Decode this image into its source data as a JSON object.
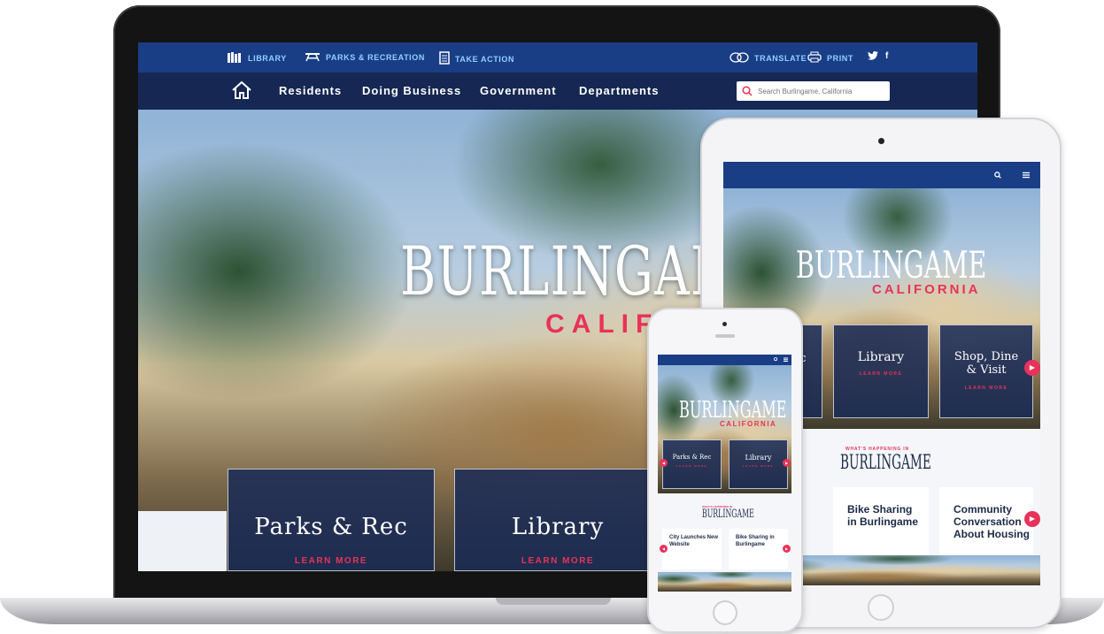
{
  "laptop": {
    "topbar": {
      "library": "LIBRARY",
      "parks": "PARKS & RECREATION",
      "take_action": "TAKE ACTION",
      "translate": "TRANSLATE",
      "print": "PRINT",
      "twitter": "y",
      "facebook": "f"
    },
    "nav": {
      "residents": "Residents",
      "doing_business": "Doing Business",
      "government": "Government",
      "departments": "Departments"
    },
    "search": {
      "placeholder": "Search Burlingame, California"
    },
    "hero": {
      "title": "BURLINGAME",
      "subtitle": "CALIFORNIA"
    },
    "cards": [
      {
        "title": "Parks & Rec",
        "link": "LEARN MORE"
      },
      {
        "title": "Library",
        "link": "LEARN MORE"
      }
    ]
  },
  "tablet": {
    "hero": {
      "title": "BURLINGAME",
      "subtitle": "CALIFORNIA"
    },
    "cards": [
      {
        "title": "ec"
      },
      {
        "title": "Library",
        "link": "LEARN MORE"
      },
      {
        "title": "Shop, Dine & Visit",
        "link": "LEARN MORE"
      }
    ],
    "section": {
      "kicker": "WHAT'S HAPPENING IN",
      "title": "BURLINGAME"
    },
    "news": [
      {
        "title": "Bike Sharing in Burlingame"
      },
      {
        "title": "Community Conversation About Housing"
      }
    ]
  },
  "phone": {
    "hero": {
      "title": "BURLINGAME",
      "subtitle": "CALIFORNIA"
    },
    "cards": [
      {
        "title": "Parks & Rec",
        "link": "LEARN MORE"
      },
      {
        "title": "Library",
        "link": "LEARN MORE"
      }
    ],
    "section": {
      "kicker": "WHAT'S HAPPENING IN",
      "title": "BURLINGAME"
    },
    "news": [
      {
        "title": "City Launches New Website"
      },
      {
        "title": "Bike Sharing in Burlingame"
      }
    ]
  },
  "colors": {
    "brand_blue": "#1a3e86",
    "accent_red": "#e8325a",
    "link_cyan": "#8fd0ff"
  },
  "icons": [
    "library-icon",
    "picnic-table-icon",
    "document-icon",
    "translate-icon",
    "print-icon",
    "twitter-icon",
    "facebook-icon",
    "home-icon",
    "search-icon",
    "menu-icon",
    "arrow-right-icon",
    "arrow-left-icon"
  ]
}
